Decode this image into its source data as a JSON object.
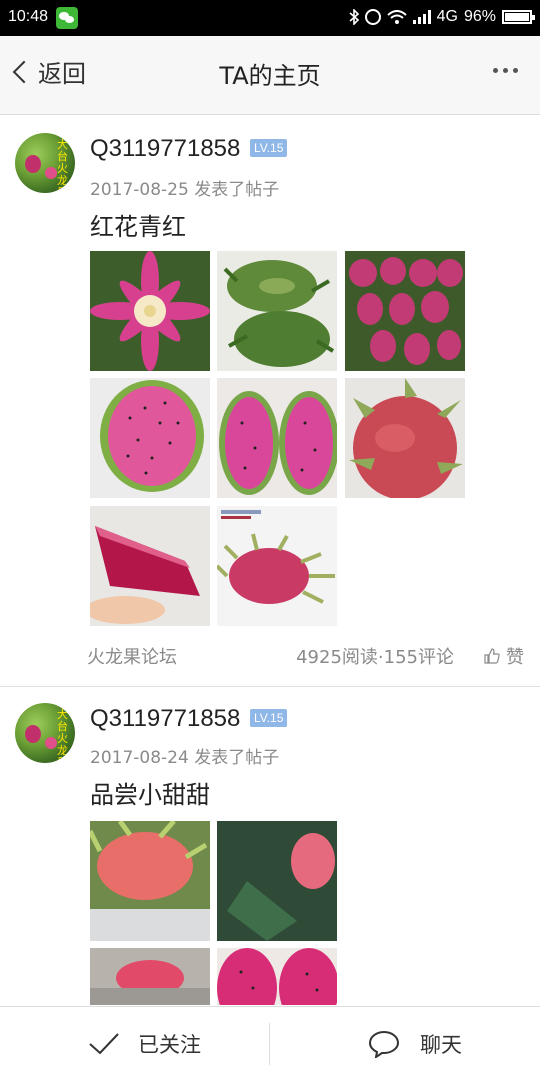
{
  "status_bar": {
    "time": "10:48",
    "network": "4G",
    "battery": "96%"
  },
  "header": {
    "back_label": "返回",
    "title": "TA的主页"
  },
  "posts": [
    {
      "username": "Q3119771858",
      "level": "LV.15",
      "date_action": "2017-08-25  发表了帖子",
      "title": "红花青红",
      "forum": "火龙果论坛",
      "stats": "4925阅读·155评论",
      "like_label": "赞"
    },
    {
      "username": "Q3119771858",
      "level": "LV.15",
      "date_action": "2017-08-24  发表了帖子",
      "title": "品尝小甜甜"
    }
  ],
  "avatar_text": "大台火龙果",
  "bottom_bar": {
    "follow_label": "已关注",
    "chat_label": "聊天"
  }
}
